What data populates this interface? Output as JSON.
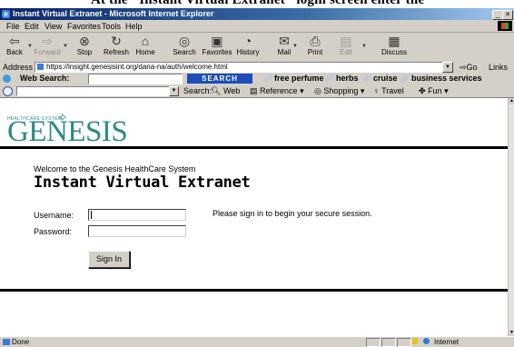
{
  "caption": "At the \"Instant Virtual Extranet\" login screen enter the",
  "window": {
    "title": "Instant Virtual Extranet - Microsoft Internet Explorer"
  },
  "menu": [
    "File",
    "Edit",
    "View",
    "Favorites",
    "Tools",
    "Help"
  ],
  "toolbar": {
    "back": "Back",
    "forward": "Forward",
    "stop": "Stop",
    "refresh": "Refresh",
    "home": "Home",
    "search": "Search",
    "favorites": "Favorites",
    "history": "History",
    "mail": "Mail",
    "print": "Print",
    "edit": "Edit",
    "discuss": "Discuss"
  },
  "address": {
    "label": "Address",
    "url": "https://insight.genesisint.org/dana-na/auth/welcome.html",
    "go": "Go",
    "links": "Links"
  },
  "websearch": {
    "label": "Web Search:",
    "button": "SEARCH",
    "links": [
      "free perfume",
      "herbs",
      "cruise",
      "business services"
    ]
  },
  "bar2": {
    "search": "Search:",
    "web": "Web",
    "reference": "Reference",
    "shopping": "Shopping",
    "travel": "Travel",
    "fun": "Fun"
  },
  "page": {
    "logo_small": "HEALTHCARE SYSTEM",
    "logo": "GENESIS",
    "welcome": "Welcome to the Genesis HealthCare System",
    "heading": "Instant Virtual Extranet",
    "username_label": "Username:",
    "password_label": "Password:",
    "prompt": "Please sign in to begin your secure session.",
    "signin": "Sign In"
  },
  "status": {
    "text": "Done",
    "zone": "Internet"
  }
}
